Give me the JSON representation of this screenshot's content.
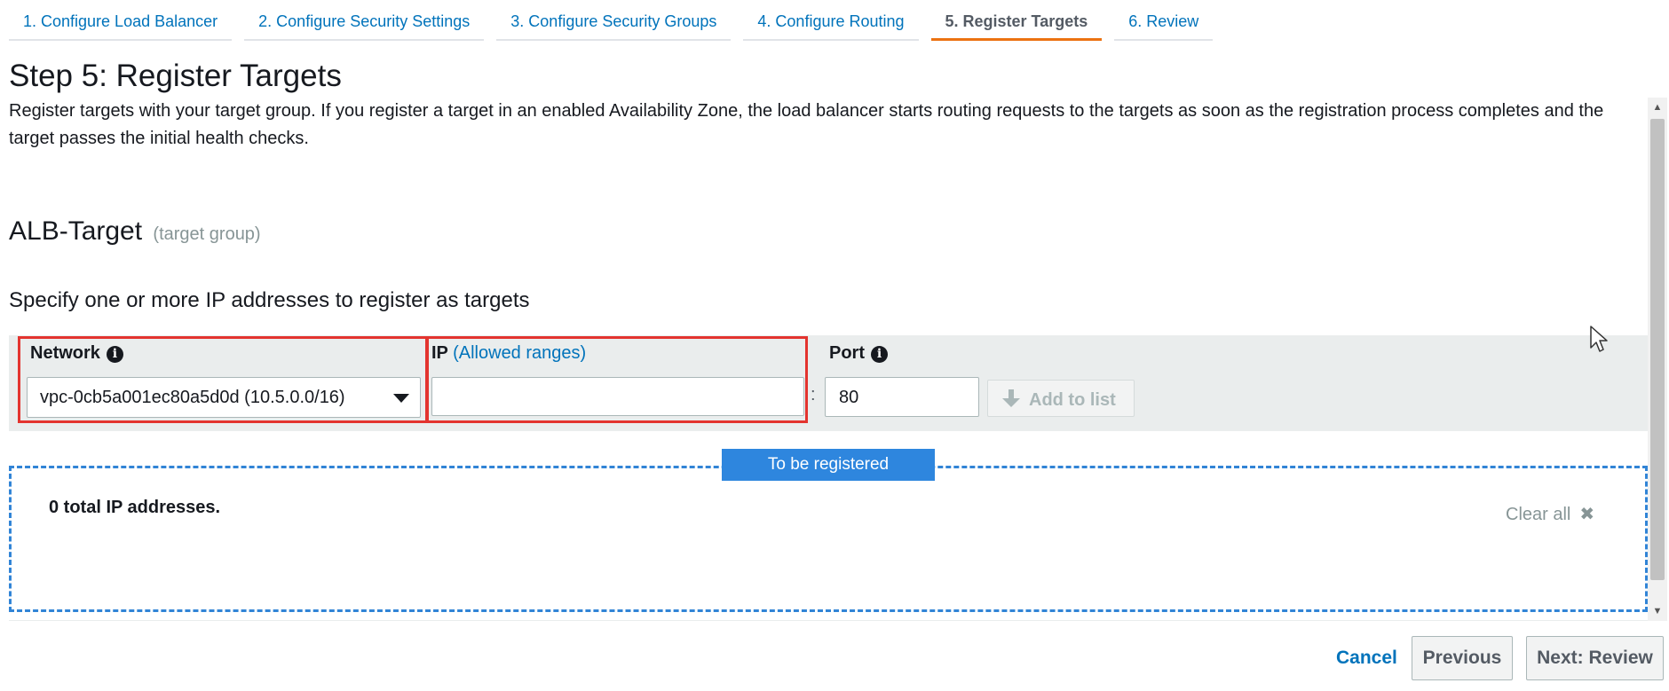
{
  "steps": [
    {
      "label": "1. Configure Load Balancer"
    },
    {
      "label": "2. Configure Security Settings"
    },
    {
      "label": "3. Configure Security Groups"
    },
    {
      "label": "4. Configure Routing"
    },
    {
      "label": "5. Register Targets",
      "active": true
    },
    {
      "label": "6. Review"
    }
  ],
  "page": {
    "title": "Step 5: Register Targets",
    "description": "Register targets with your target group. If you register a target in an enabled Availability Zone, the load balancer starts routing requests to the targets as soon as the registration process completes and the target passes the initial health checks."
  },
  "target_group": {
    "name": "ALB-Target",
    "type_label": "(target group)"
  },
  "instructions": "Specify one or more IP addresses to register as targets",
  "form": {
    "network_label": "Network",
    "network_value": "vpc-0cb5a001ec80a5d0d (10.5.0.0/16)",
    "ip_label": "IP",
    "ip_link": "(Allowed ranges)",
    "ip_value": "",
    "colon": ":",
    "port_label": "Port",
    "port_value": "80",
    "add_button": "Add to list"
  },
  "registration": {
    "tag": "To be registered",
    "total_text": "0 total IP addresses.",
    "clear_all": "Clear all",
    "clear_icon": "✖"
  },
  "footer": {
    "cancel": "Cancel",
    "previous": "Previous",
    "next": "Next: Review"
  },
  "colors": {
    "accent": "#0073bb",
    "active_step_underline": "#ec7211",
    "highlight_box": "#e3342f",
    "registered_tag": "#2e86de"
  }
}
